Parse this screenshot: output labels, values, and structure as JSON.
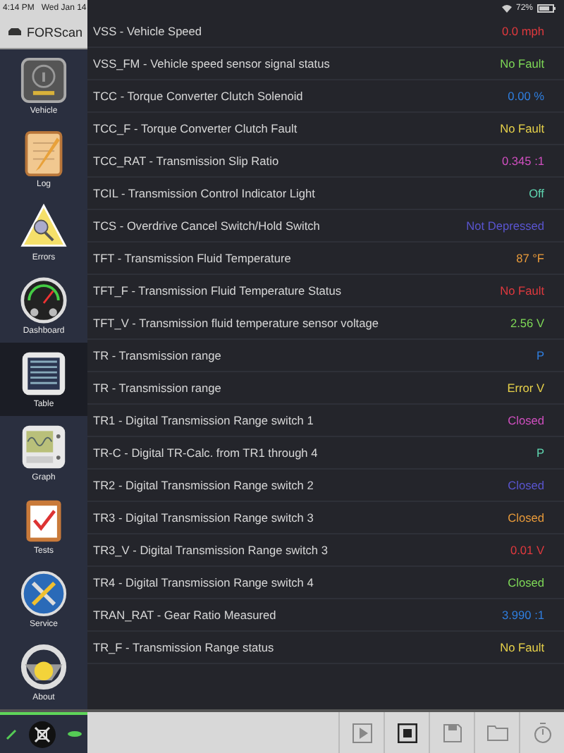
{
  "status_bar": {
    "time": "4:14 PM",
    "date": "Wed Jan 14",
    "battery": "72%"
  },
  "app_title": "FORScan",
  "nav": [
    {
      "label": "Vehicle",
      "kind": "info",
      "selected": false
    },
    {
      "label": "Log",
      "kind": "notepad",
      "selected": false
    },
    {
      "label": "Errors",
      "kind": "warning",
      "selected": false
    },
    {
      "label": "Dashboard",
      "kind": "gauge",
      "selected": false
    },
    {
      "label": "Table",
      "kind": "table",
      "selected": true
    },
    {
      "label": "Graph",
      "kind": "graph",
      "selected": false
    },
    {
      "label": "Tests",
      "kind": "checklist",
      "selected": false
    },
    {
      "label": "Service",
      "kind": "tools",
      "selected": false
    },
    {
      "label": "About",
      "kind": "wheel",
      "selected": false
    }
  ],
  "rows": [
    {
      "name": "VSS - Vehicle Speed",
      "value": "0.0 mph",
      "color": "#e0393e"
    },
    {
      "name": "VSS_FM - Vehicle speed sensor signal status",
      "value": "No Fault",
      "color": "#7ed957"
    },
    {
      "name": "TCC - Torque Converter Clutch Solenoid",
      "value": "0.00 %",
      "color": "#2f7fe0"
    },
    {
      "name": "TCC_F - Torque Converter Clutch Fault",
      "value": "No Fault",
      "color": "#e8d24a"
    },
    {
      "name": "TCC_RAT - Transmission Slip Ratio",
      "value": "0.345 :1",
      "color": "#d04fc0"
    },
    {
      "name": "TCIL - Transmission Control Indicator Light",
      "value": "Off",
      "color": "#5fd6b0"
    },
    {
      "name": "TCS - Overdrive Cancel Switch/Hold Switch",
      "value": "Not Depressed",
      "color": "#5a55d0"
    },
    {
      "name": "TFT - Transmission Fluid Temperature",
      "value": "87 °F",
      "color": "#e89a3a"
    },
    {
      "name": "TFT_F - Transmission Fluid Temperature Status",
      "value": "No Fault",
      "color": "#e0393e"
    },
    {
      "name": "TFT_V - Transmission fluid temperature sensor voltage",
      "value": "2.56 V",
      "color": "#7ed957"
    },
    {
      "name": "TR - Transmission range",
      "value": "P",
      "color": "#2f7fe0"
    },
    {
      "name": "TR - Transmission range",
      "value": "Error V",
      "color": "#e8d24a"
    },
    {
      "name": "TR1 - Digital Transmission Range switch 1",
      "value": "Closed",
      "color": "#d04fc0"
    },
    {
      "name": "TR-C - Digital TR-Calc. from TR1 through 4",
      "value": "P",
      "color": "#5fd6b0"
    },
    {
      "name": "TR2 - Digital Transmission Range switch 2",
      "value": "Closed",
      "color": "#5a55d0"
    },
    {
      "name": "TR3 - Digital Transmission Range switch 3",
      "value": "Closed",
      "color": "#e89a3a"
    },
    {
      "name": "TR3_V - Digital Transmission Range switch 3",
      "value": "0.01 V",
      "color": "#e0393e"
    },
    {
      "name": "TR4 - Digital Transmission Range switch 4",
      "value": "Closed",
      "color": "#7ed957"
    },
    {
      "name": "TRAN_RAT - Gear Ratio Measured",
      "value": "3.990 :1",
      "color": "#2f7fe0"
    },
    {
      "name": "TR_F - Transmission Range status",
      "value": "No Fault",
      "color": "#e8d24a"
    }
  ]
}
